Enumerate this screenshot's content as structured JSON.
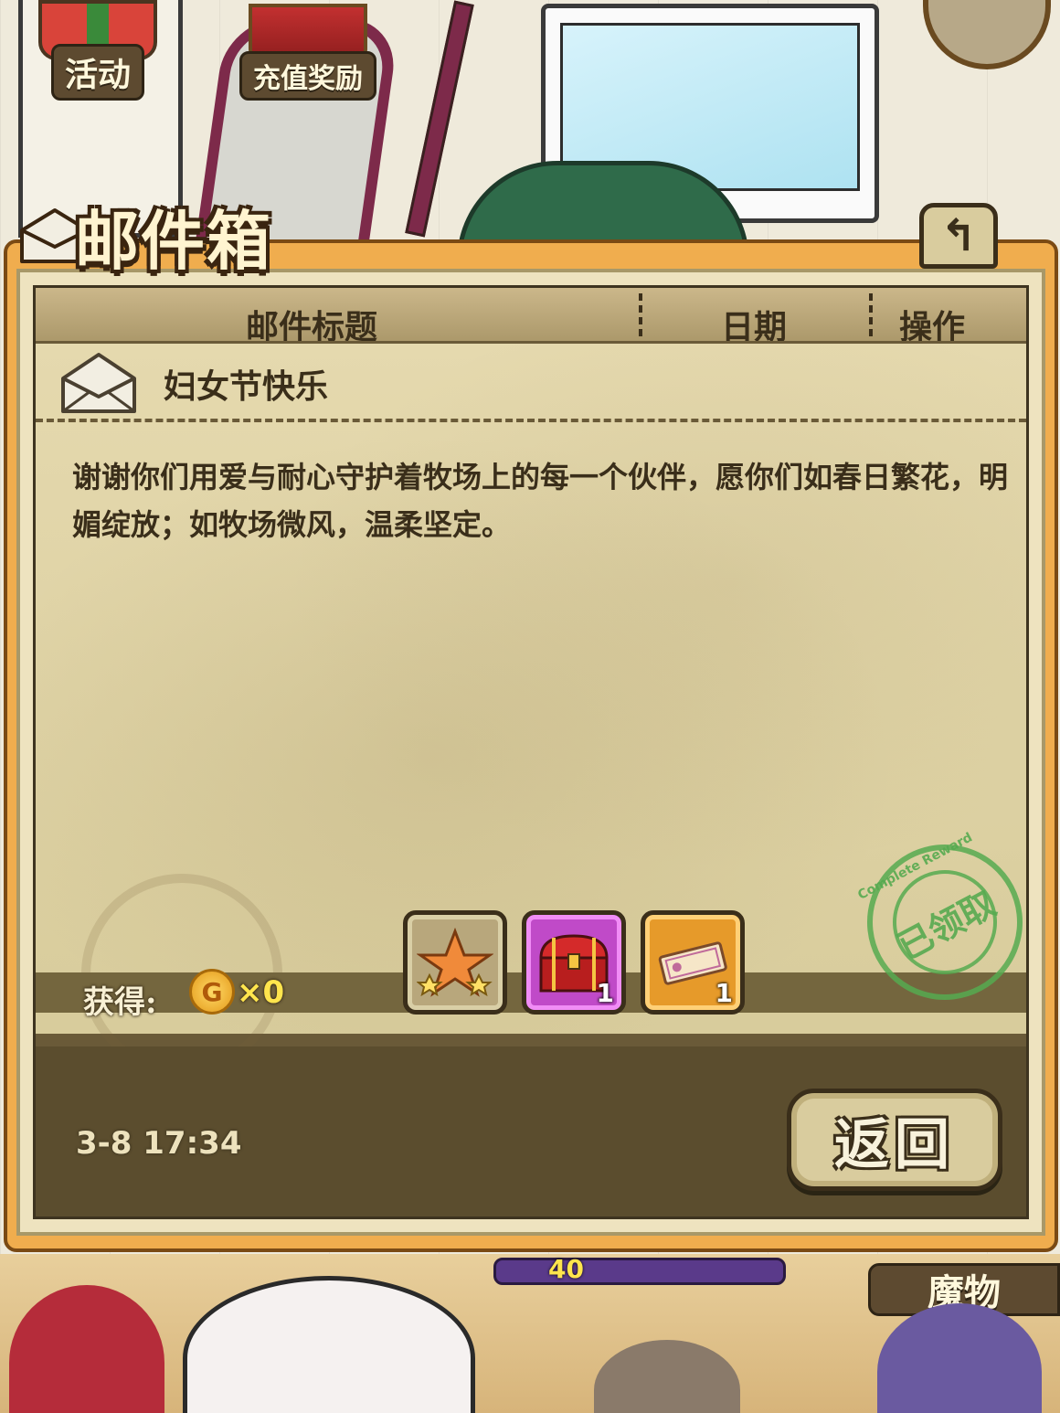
{
  "top_menu": {
    "activity_label": "活动",
    "recharge_label": "充值奖励"
  },
  "mailbox": {
    "title": "邮件箱",
    "columns": {
      "title": "邮件标题",
      "date": "日期",
      "action": "操作"
    },
    "mail": {
      "subject": "妇女节快乐",
      "body": "谢谢你们用爱与耐心守护着牧场上的每一个伙伴，愿你们如春日繁花，明媚绽放；如牧场微风，温柔坚定。",
      "obtain_label": "获得:",
      "coin_symbol": "G",
      "coin_count": "×0",
      "attachments": [
        {
          "icon": "star-cluster-icon",
          "count": ""
        },
        {
          "icon": "treasure-chest-icon",
          "count": "1"
        },
        {
          "icon": "ticket-icon",
          "count": "1"
        }
      ],
      "stamp_text": "已领取",
      "stamp_ring": "Complete Reward",
      "date": "3-8 17:34"
    },
    "back_button_label": "返回"
  },
  "bottom_bar": {
    "level": "40",
    "monster_tab": "魔物"
  },
  "colors": {
    "panel_border": "#f0ad4e",
    "parchment": "#e5d9ae",
    "stamp_green": "#56aa50",
    "coin_gold": "#ffe54d"
  }
}
